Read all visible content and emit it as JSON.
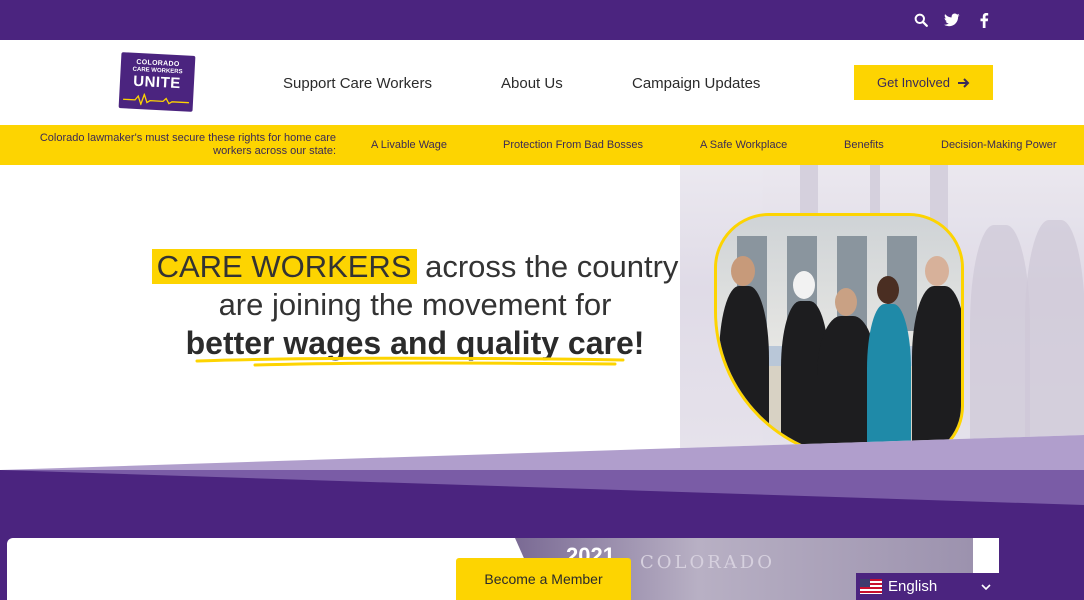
{
  "topbar": {
    "icons": [
      "search-icon",
      "twitter-icon",
      "facebook-icon"
    ]
  },
  "header": {
    "logo": {
      "line1": "COLORADO",
      "line2": "CARE WORKERS",
      "line3": "UNITE"
    },
    "nav": [
      {
        "label": "Support Care Workers"
      },
      {
        "label": "About Us"
      },
      {
        "label": "Campaign Updates"
      }
    ],
    "cta": {
      "label": "Get Involved",
      "icon": "arrow-right-icon"
    }
  },
  "rights_bar": {
    "intro": "Colorado lawmaker's must secure these rights for home care workers across our state:",
    "items": [
      {
        "label": "A Livable Wage"
      },
      {
        "label": "Protection From Bad Bosses"
      },
      {
        "label": "A Safe Workplace"
      },
      {
        "label": "Benefits"
      },
      {
        "label": "Decision-Making Power"
      }
    ]
  },
  "hero": {
    "highlight": "CARE WORKERS",
    "line1_rest": " across the country",
    "line2": "are joining the movement for",
    "line3": "better wages and quality care!"
  },
  "timeline": {
    "year": "2021",
    "engraving": "COLORADO"
  },
  "floating": {
    "member_button": "Become a Member",
    "language": "English"
  },
  "colors": {
    "brand_purple": "#4b247f",
    "brand_yellow": "#fdd401"
  }
}
